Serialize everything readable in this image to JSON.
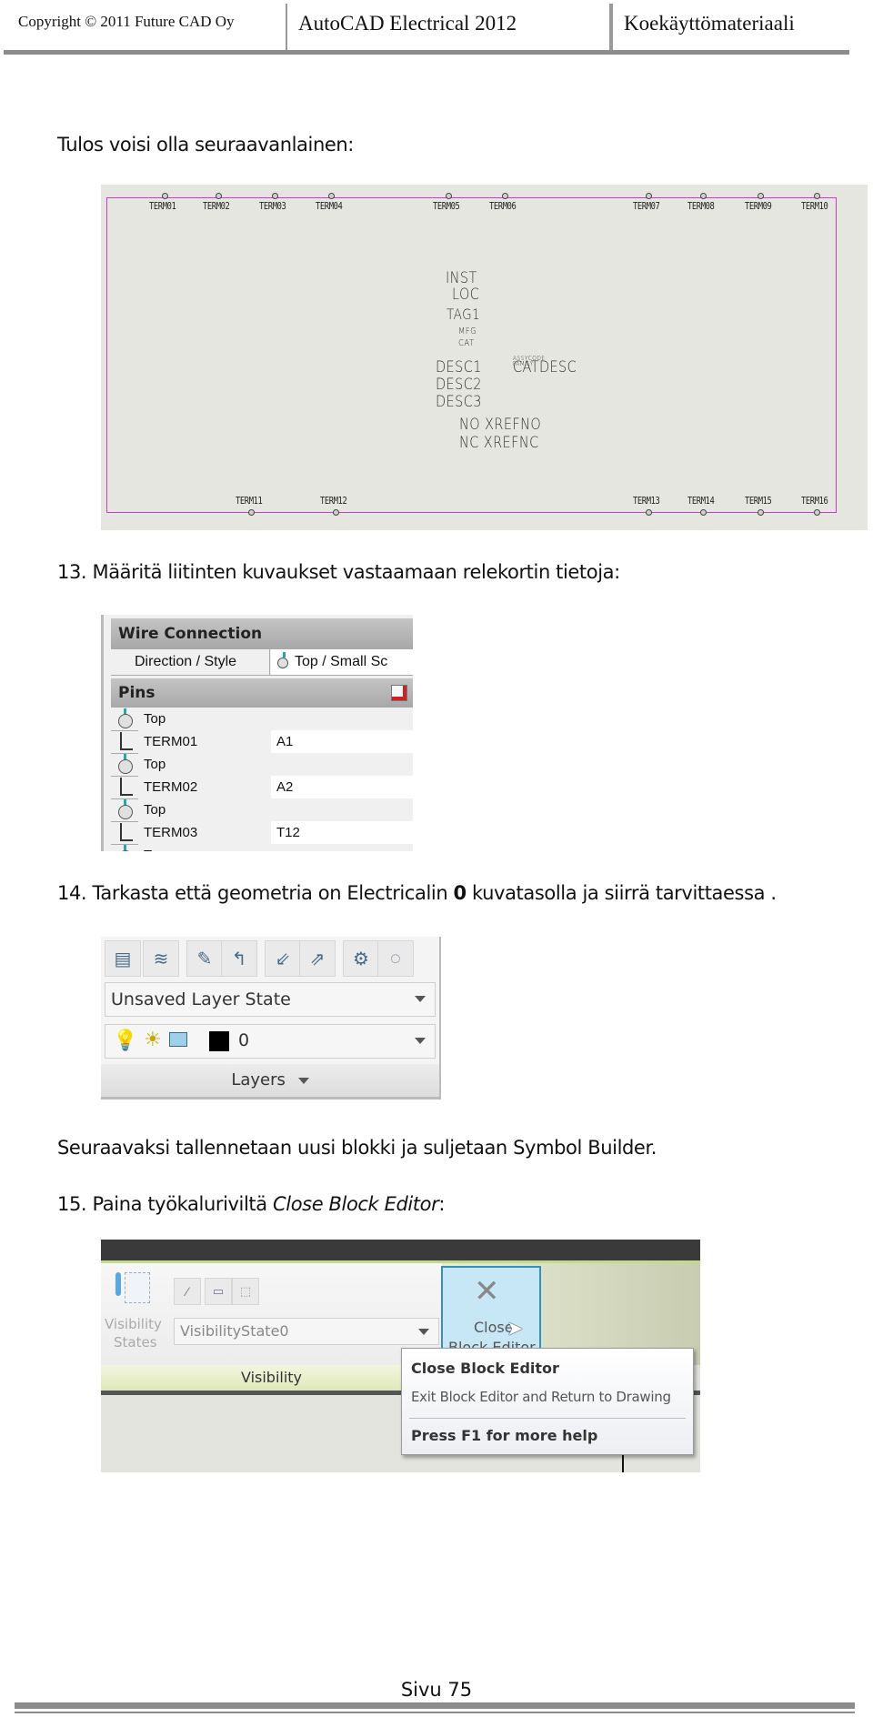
{
  "header": {
    "copyright": "Copyright © 2011 Future CAD Oy",
    "product": "AutoCAD Electrical 2012",
    "label": "Koekäyttömateriaali"
  },
  "paragraphs": {
    "result_intro": "Tulos voisi olla seuraavanlainen:",
    "step13": "13.  Määritä liitinten kuvaukset vastaamaan relekortin tietoja:",
    "step14_pre": "14.  Tarkasta  että geometria on Electricalin ",
    "step14_bold": "0",
    "step14_post": " kuvatasolla ja siirrä tarvittaessa .",
    "save_intro": "Seuraavaksi tallennetaan uusi blokki ja suljetaan Symbol Builder.",
    "step15_pre": "15.  Paina työkaluriviltä ",
    "step15_italic": "Close Block Editor",
    "step15_post": ":"
  },
  "schematic": {
    "top_terminals": [
      "TERM01",
      "TERM02",
      "TERM03",
      "TERM04",
      "TERM05",
      "TERM06",
      "TERM07",
      "TERM08",
      "TERM09",
      "TERM10"
    ],
    "bottom_terminals": [
      "TERM11",
      "TERM12",
      "TERM13",
      "TERM14",
      "TERM15",
      "TERM16"
    ],
    "attributes": {
      "inst": "INST",
      "loc": "LOC",
      "tag": "TAG1",
      "mfg": "MFG",
      "cat": "CAT",
      "assycode": "ASSYCODE",
      "family": "FAMILY",
      "catdesc": "CATDESC",
      "desc1": "DESC1",
      "desc2": "DESC2",
      "desc3": "DESC3",
      "no": "NO XREFNO",
      "nc": "NC XREFNC"
    },
    "border_color": "#c83cc8"
  },
  "properties": {
    "section_wire": "Wire Connection",
    "direction_label": "Direction / Style",
    "direction_value": "Top / Small Sc",
    "section_pins": "Pins",
    "pins": [
      {
        "direction": "Top",
        "name": "TERM01",
        "value": "A1"
      },
      {
        "direction": "Top",
        "name": "TERM02",
        "value": "A2"
      },
      {
        "direction": "Top",
        "name": "TERM03",
        "value": "T12"
      },
      {
        "direction": "Top"
      }
    ]
  },
  "layers_panel": {
    "tool_icons": [
      "layer-properties-icon",
      "layer-match-icon",
      "layer-isolate-icon",
      "layer-previous-icon",
      "layer-freeze-icon",
      "layer-off-icon",
      "layer-settings-icon",
      "layer-on-icon"
    ],
    "layer_state": "Unsaved Layer State",
    "current_layer": "0",
    "current_layer_color": "#000000",
    "footer": "Layers"
  },
  "ribbon": {
    "visibility_states_label_1": "Visibility",
    "visibility_states_label_2": "States",
    "visibility_state_value": "VisibilityState0",
    "visibility_footer": "Visibility",
    "close_button_label": "Close",
    "close_button_label_2": "Block Editor",
    "tooltip": {
      "title": "Close Block Editor",
      "description": "Exit Block Editor and Return to Drawing",
      "help": "Press F1 for more help"
    }
  },
  "footer": {
    "page": "Sivu 75"
  }
}
